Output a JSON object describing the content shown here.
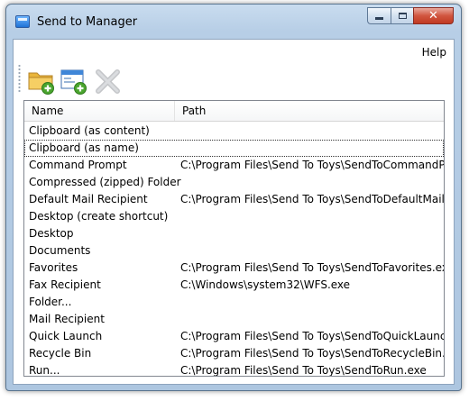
{
  "window": {
    "title": "Send to Manager",
    "caption": {
      "minimize": "",
      "maximize": "",
      "close": "✕"
    }
  },
  "menu": {
    "help": "Help"
  },
  "toolbar": {
    "buttons": [
      {
        "name": "add-folder-button",
        "icon": "folder-add-icon"
      },
      {
        "name": "add-item-button",
        "icon": "window-add-icon"
      },
      {
        "name": "delete-button",
        "icon": "delete-x-icon"
      }
    ]
  },
  "list": {
    "columns": {
      "name": "Name",
      "path": "Path"
    },
    "focused_index": 1,
    "rows": [
      {
        "name": "Clipboard (as content)",
        "path": ""
      },
      {
        "name": "Clipboard (as name)",
        "path": ""
      },
      {
        "name": "Command Prompt",
        "path": "C:\\Program Files\\Send To Toys\\SendToCommandPro..."
      },
      {
        "name": "Compressed (zipped) Folder",
        "path": ""
      },
      {
        "name": "Default Mail Recipient",
        "path": "C:\\Program Files\\Send To Toys\\SendToDefaultMailReci..."
      },
      {
        "name": "Desktop (create shortcut)",
        "path": ""
      },
      {
        "name": "Desktop",
        "path": ""
      },
      {
        "name": "Documents",
        "path": ""
      },
      {
        "name": "Favorites",
        "path": "C:\\Program Files\\Send To Toys\\SendToFavorites.exe"
      },
      {
        "name": "Fax Recipient",
        "path": "C:\\Windows\\system32\\WFS.exe"
      },
      {
        "name": "Folder...",
        "path": ""
      },
      {
        "name": "Mail Recipient",
        "path": ""
      },
      {
        "name": "Quick Launch",
        "path": "C:\\Program Files\\Send To Toys\\SendToQuickLaunch.exe"
      },
      {
        "name": "Recycle Bin",
        "path": "C:\\Program Files\\Send To Toys\\SendToRecycleBin.exe"
      },
      {
        "name": "Run...",
        "path": "C:\\Program Files\\Send To Toys\\SendToRun.exe"
      }
    ]
  }
}
